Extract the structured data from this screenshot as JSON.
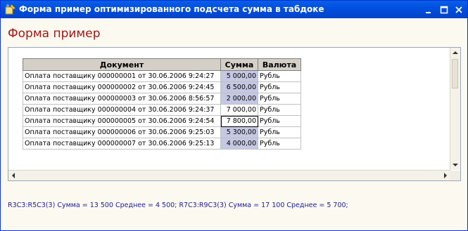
{
  "window": {
    "title": "Форма пример оптимизированного подсчета сумма в табдоке",
    "buttons": {
      "minimize": "_",
      "maximize": "□",
      "close": "✕"
    },
    "icon": "1c-form-icon",
    "titlebar_color": "#0050e0"
  },
  "form": {
    "title": "Форма пример"
  },
  "table": {
    "headers": [
      "Документ",
      "Сумма",
      "Валюта"
    ],
    "rows": [
      {
        "doc": "Оплата поставщику 000000001 от 30.06.2006 9:24:27",
        "sum": "5 000,00",
        "cur": "Рубль",
        "selected": true
      },
      {
        "doc": "Оплата поставщику 000000002 от 30.06.2006 9:24:45",
        "sum": "6 500,00",
        "cur": "Рубль",
        "selected": true
      },
      {
        "doc": "Оплата поставщику 000000003 от 30.06.2006 8:56:57",
        "sum": "2 000,00",
        "cur": "Рубль",
        "selected": true
      },
      {
        "doc": "Оплата поставщику 000000004 от 30.06.2006 9:24:37",
        "sum": "7 000,00",
        "cur": "Рубль",
        "selected": false
      },
      {
        "doc": "Оплата поставщику 000000005 от 30.06.2006 9:24:54",
        "sum": "7 800,00",
        "cur": "Рубль",
        "selected": true
      },
      {
        "doc": "Оплата поставщику 000000006 от 30.06.2006 9:25:03",
        "sum": "5 300,00",
        "cur": "Рубль",
        "selected": true
      },
      {
        "doc": "Оплата поставщику 000000007 от 30.06.2006 9:25:13",
        "sum": "4 000,00",
        "cur": "Рубль",
        "selected": true
      }
    ],
    "selection_color": "#c5c8e4"
  },
  "status": {
    "text": "R3C3:R5C3(3) Сумма = 13 500 Среднее = 4 500; R7C3:R9C3(3) Сумма = 17 100 Среднее = 5 700;"
  },
  "colors": {
    "form_title": "#a31515",
    "status_text": "#1b1b9a"
  }
}
